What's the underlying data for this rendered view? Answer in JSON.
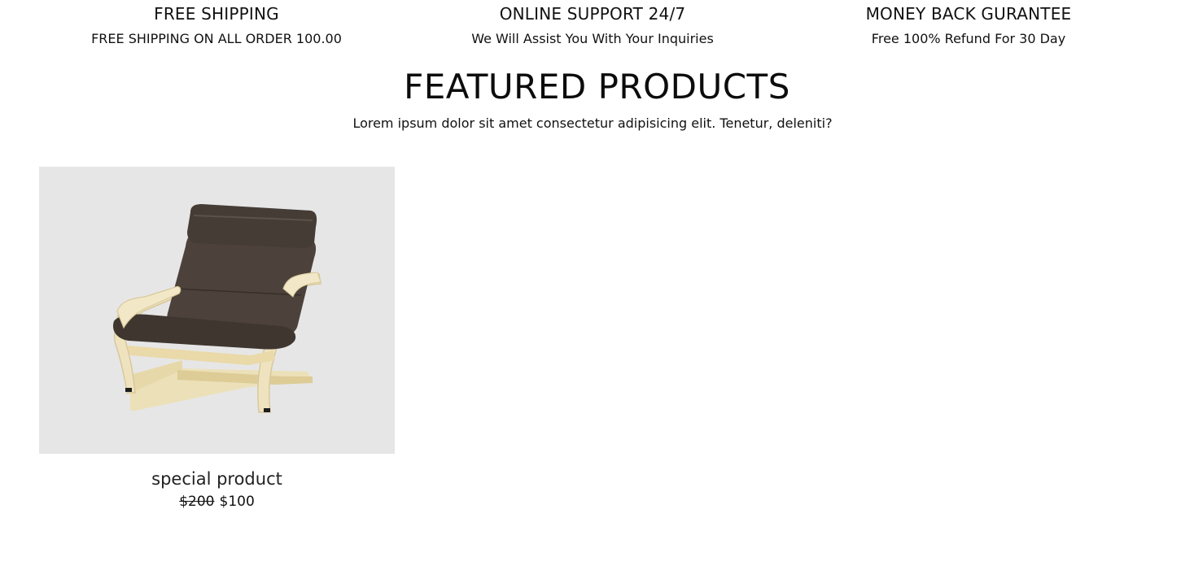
{
  "features": [
    {
      "title": "FREE SHIPPING",
      "description": "FREE SHIPPING ON ALL ORDER 100.00"
    },
    {
      "title": "ONLINE SUPPORT 24/7",
      "description": "We Will Assist You With Your Inquiries"
    },
    {
      "title": "MONEY BACK GURANTEE",
      "description": "Free 100% Refund For 30 Day"
    }
  ],
  "featured": {
    "title": "FEATURED PRODUCTS",
    "subtitle": "Lorem ipsum dolor sit amet consectetur adipisicing elit. Tenetur, deleniti?"
  },
  "products": [
    {
      "name": "special product",
      "old_price": "$200",
      "price": "$100",
      "image": "armchair-image"
    }
  ]
}
